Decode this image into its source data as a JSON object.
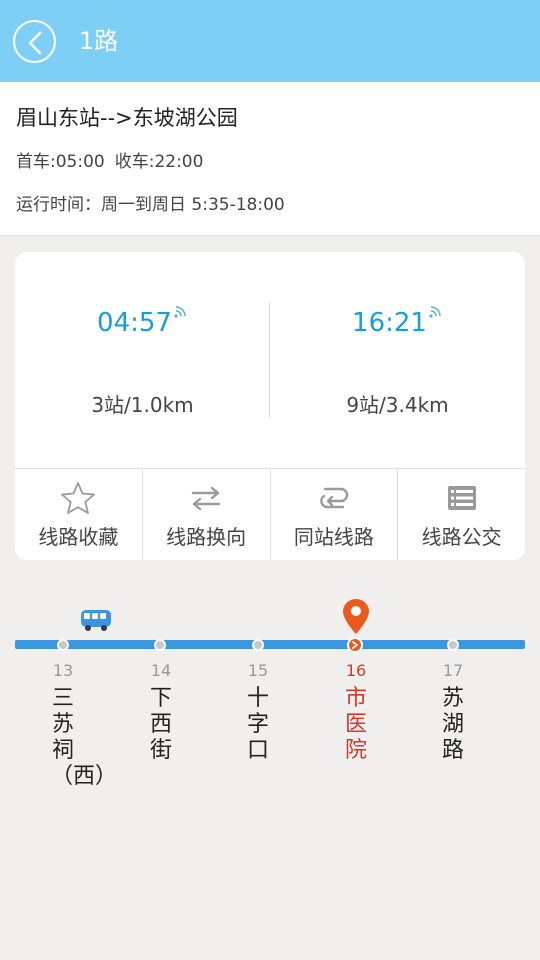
{
  "header": {
    "title": "1路"
  },
  "route": {
    "name": "眉山东站-->东坡湖公园",
    "first_bus": "首车:05:00",
    "last_bus": "收车:22:00",
    "schedule": "运行时间：周一到周日 5:35-18:00"
  },
  "arrivals": [
    {
      "time": "04:57",
      "distance": "3站/1.0km"
    },
    {
      "time": "16:21",
      "distance": "9站/3.4km"
    }
  ],
  "actions": [
    {
      "label": "线路收藏",
      "icon": "star-icon"
    },
    {
      "label": "线路换向",
      "icon": "swap-arrows-icon"
    },
    {
      "label": "同站线路",
      "icon": "transfer-route-icon"
    },
    {
      "label": "线路公交",
      "icon": "list-icon"
    }
  ],
  "stops": [
    {
      "num": "13",
      "name": "三苏祠（西）"
    },
    {
      "num": "14",
      "name": "下西街"
    },
    {
      "num": "15",
      "name": "十字口"
    },
    {
      "num": "16",
      "name": "市医院",
      "current": true
    },
    {
      "num": "17",
      "name": "苏湖路"
    }
  ],
  "colors": {
    "header": "#7ecff5",
    "accent_blue": "#1a9ed8",
    "track": "#3a96de",
    "current_stop": "#d23a2a",
    "pin": "#ea5a1e"
  }
}
